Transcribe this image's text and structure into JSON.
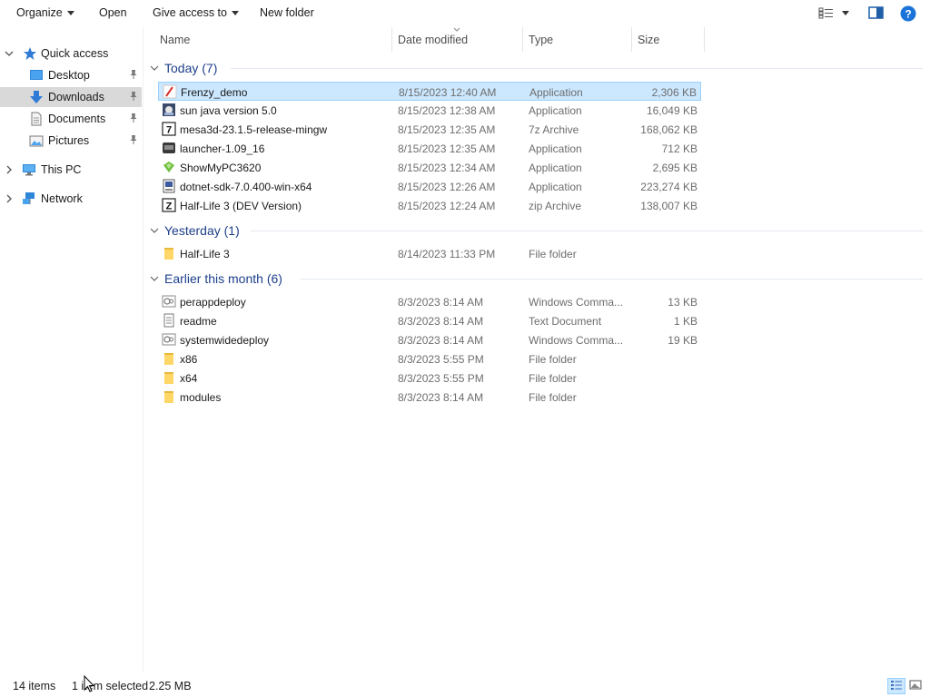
{
  "toolbar": {
    "organize": "Organize",
    "open": "Open",
    "give_access": "Give access to",
    "new_folder": "New folder"
  },
  "nav": {
    "quick_access": "Quick access",
    "desktop": "Desktop",
    "downloads": "Downloads",
    "documents": "Documents",
    "pictures": "Pictures",
    "this_pc": "This PC",
    "network": "Network"
  },
  "columns": {
    "name": "Name",
    "date": "Date modified",
    "type": "Type",
    "size": "Size"
  },
  "groups": {
    "today": "Today (7)",
    "yesterday": "Yesterday (1)",
    "earlier": "Earlier this month (6)"
  },
  "files": [
    {
      "name": "Frenzy_demo",
      "date": "8/15/2023 12:40 AM",
      "type": "Application",
      "size": "2,306 KB",
      "icon": "frenzy-app-icon"
    },
    {
      "name": "sun java version 5.0",
      "date": "8/15/2023 12:38 AM",
      "type": "Application",
      "size": "16,049 KB",
      "icon": "installer-app-icon"
    },
    {
      "name": "mesa3d-23.1.5-release-mingw",
      "date": "8/15/2023 12:35 AM",
      "type": "7z Archive",
      "size": "168,062 KB",
      "icon": "7z-archive-icon"
    },
    {
      "name": "launcher-1.09_16",
      "date": "8/15/2023 12:35 AM",
      "type": "Application",
      "size": "712 KB",
      "icon": "launcher-app-icon"
    },
    {
      "name": "ShowMyPC3620",
      "date": "8/15/2023 12:34 AM",
      "type": "Application",
      "size": "2,695 KB",
      "icon": "showmypc-app-icon"
    },
    {
      "name": "dotnet-sdk-7.0.400-win-x64",
      "date": "8/15/2023 12:26 AM",
      "type": "Application",
      "size": "223,274 KB",
      "icon": "dotnet-installer-icon"
    },
    {
      "name": "Half-Life 3 (DEV Version)",
      "date": "8/15/2023 12:24 AM",
      "type": "zip Archive",
      "size": "138,007 KB",
      "icon": "zip-archive-icon"
    },
    {
      "name": "Half-Life 3",
      "date": "8/14/2023 11:33 PM",
      "type": "File folder",
      "size": "",
      "icon": "folder-icon"
    },
    {
      "name": "perappdeploy",
      "date": "8/3/2023 8:14 AM",
      "type": "Windows Comma...",
      "size": "13 KB",
      "icon": "cmd-script-icon"
    },
    {
      "name": "readme",
      "date": "8/3/2023 8:14 AM",
      "type": "Text Document",
      "size": "1 KB",
      "icon": "text-document-icon"
    },
    {
      "name": "systemwidedeploy",
      "date": "8/3/2023 8:14 AM",
      "type": "Windows Comma...",
      "size": "19 KB",
      "icon": "cmd-script-icon"
    },
    {
      "name": "x86",
      "date": "8/3/2023 5:55 PM",
      "type": "File folder",
      "size": "",
      "icon": "folder-icon"
    },
    {
      "name": "x64",
      "date": "8/3/2023 5:55 PM",
      "type": "File folder",
      "size": "",
      "icon": "folder-icon"
    },
    {
      "name": "modules",
      "date": "8/3/2023 8:14 AM",
      "type": "File folder",
      "size": "",
      "icon": "folder-icon"
    }
  ],
  "status": {
    "items": "14 items",
    "selected": "1 item selected",
    "selected_size": "2.25 MB"
  },
  "colors": {
    "selection_bg": "#cce8ff",
    "selection_border": "#99d1ff",
    "group_header": "#1e3f8a",
    "nav_selected": "#d9d9d9",
    "help_blue": "#1a73d9",
    "folder_yellow": "#ffd767"
  }
}
